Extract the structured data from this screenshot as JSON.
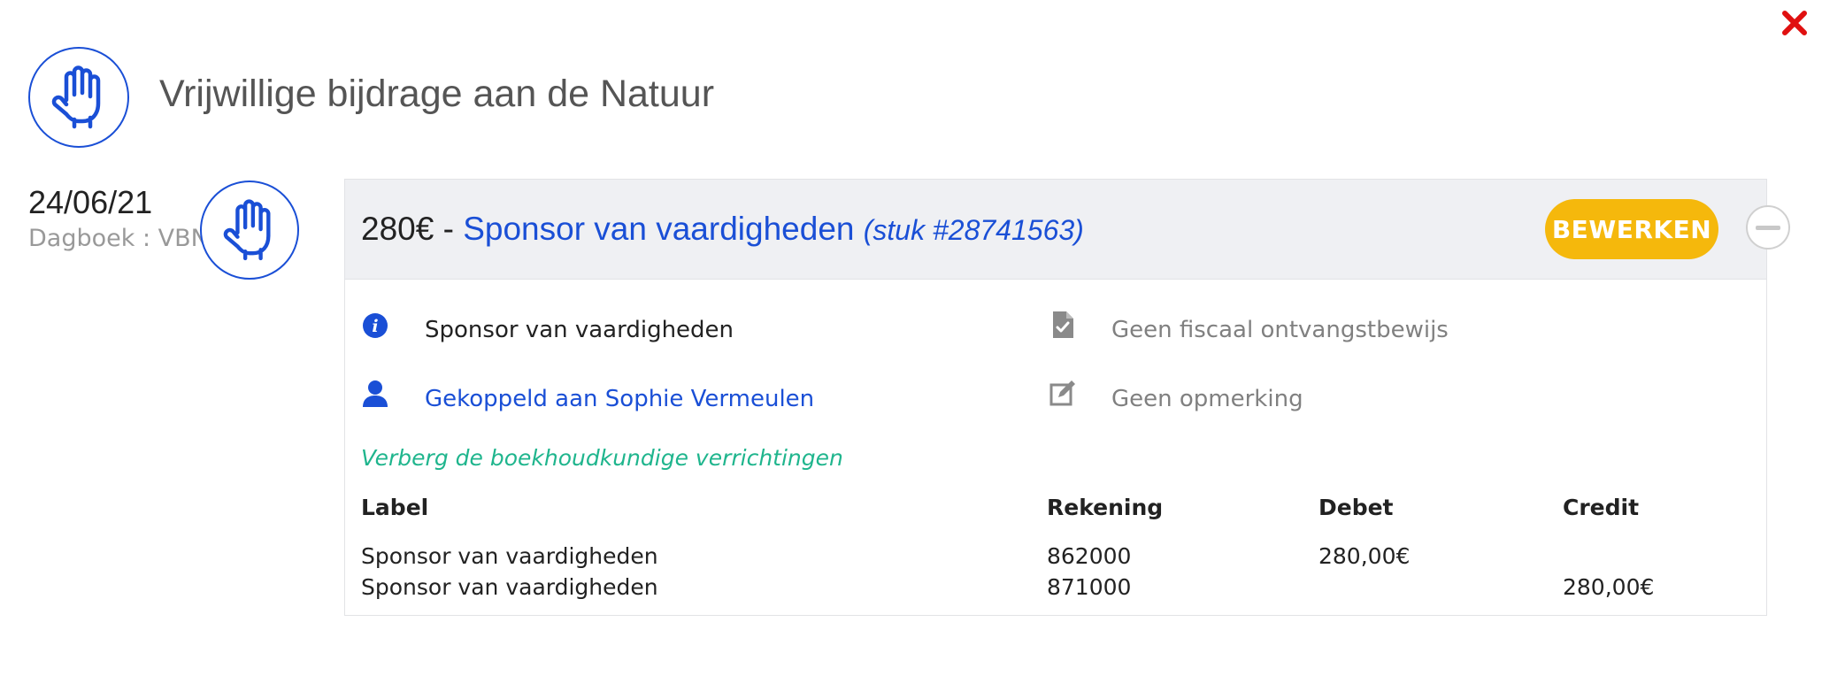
{
  "page": {
    "title": "Vrijwillige bijdrage aan de Natuur"
  },
  "entry": {
    "date": "24/06/21",
    "journal": "Dagboek : VBN",
    "amount": "280€",
    "separator": " - ",
    "name": "Sponsor van vaardigheden",
    "piece": "(stuk #28741563)",
    "edit_label": "BEWERKEN",
    "info_label": "Sponsor van vaardigheden",
    "linked_label": "Gekoppeld aan Sophie Vermeulen",
    "receipt_label": "Geen fiscaal ontvangstbewijs",
    "remark_label": "Geen opmerking",
    "toggle_label": "Verberg de boekhoudkundige verrichtingen"
  },
  "table": {
    "headers": {
      "label": "Label",
      "account": "Rekening",
      "debit": "Debet",
      "credit": "Credit"
    },
    "rows": [
      {
        "label": "Sponsor van vaardigheden",
        "account": "862000",
        "debit": "280,00€",
        "credit": ""
      },
      {
        "label": "Sponsor van vaardigheden",
        "account": "871000",
        "debit": "",
        "credit": "280,00€"
      }
    ]
  },
  "colors": {
    "brand_blue": "#1a4fd6",
    "edit_button": "#f5b80c",
    "toggle_link": "#1fb58d",
    "close_red": "#e01010",
    "header_bg": "#eff0f3"
  },
  "icons": {
    "close": "close-icon",
    "category": "raised-hand-icon",
    "info": "info-icon",
    "user": "user-icon",
    "receipt": "document-check-icon",
    "remark": "edit-note-icon",
    "collapse": "minus-circle-icon"
  }
}
